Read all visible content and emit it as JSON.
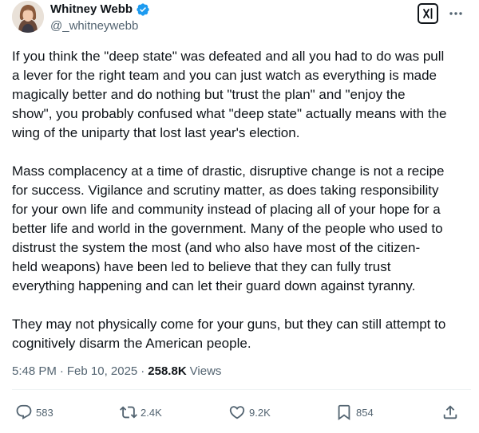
{
  "author": {
    "display_name": "Whitney Webb",
    "handle": "@_whitneywebb",
    "verified": true
  },
  "icons": {
    "verified": "verified-badge-icon",
    "grok": "grok-icon",
    "more": "more-icon",
    "reply": "reply-icon",
    "repost": "repost-icon",
    "like": "like-icon",
    "bookmark": "bookmark-icon",
    "share": "share-icon"
  },
  "colors": {
    "text": "#0f1419",
    "secondary": "#536471",
    "verified_blue": "#1d9bf0",
    "divider": "#eff3f4"
  },
  "tweet": {
    "paragraphs": [
      "If you think the \"deep state\" was defeated and all you had to do was pull\na lever for the right team and you can just watch as everything is made\nmagically better and do nothing but \"trust the plan\" and \"enjoy the\nshow\", you probably confused what \"deep state\" actually means with the\nwing of the uniparty that lost last year's election.",
      "Mass complacency at a time of drastic, disruptive change is not a recipe\nfor success. Vigilance and scrutiny matter, as does taking responsibility\nfor your own life and community instead of placing all of your hope for a\nbetter life and world in the government. Many of the people who used to\ndistrust the system the most (and who also have most of the citizen-\nheld weapons) have been led to believe that they can fully trust\neverything happening and can let their guard down against tyranny.",
      "They may not physically come for your guns, but they can still attempt to\ncognitively disarm the American people."
    ],
    "time": "5:48 PM",
    "separator": "·",
    "date": "Feb 10, 2025",
    "views_count": "258.8K",
    "views_label": "Views"
  },
  "actions": {
    "replies": "583",
    "reposts": "2.4K",
    "likes": "9.2K",
    "bookmarks": "854"
  }
}
